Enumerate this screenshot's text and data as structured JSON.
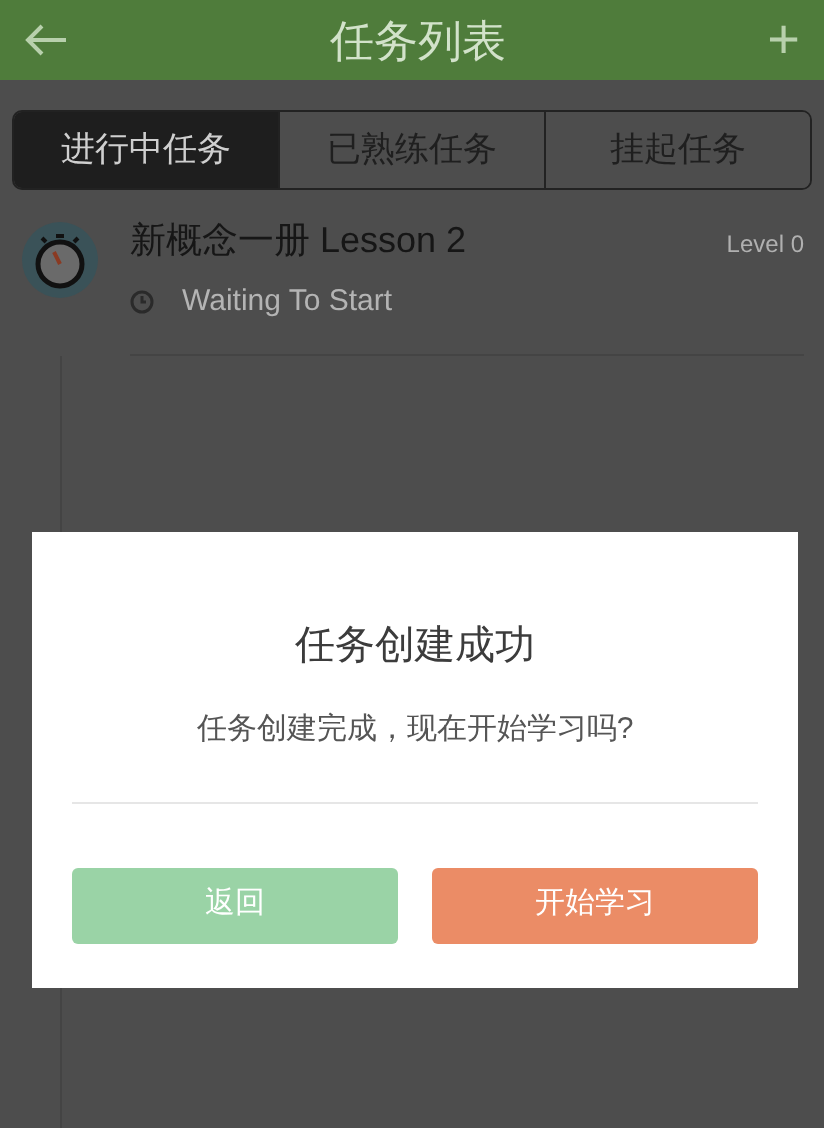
{
  "header": {
    "title": "任务列表",
    "add_label": "+"
  },
  "tabs": [
    {
      "label": "进行中任务",
      "selected": true
    },
    {
      "label": "已熟练任务",
      "selected": false
    },
    {
      "label": "挂起任务",
      "selected": false
    }
  ],
  "tasks": [
    {
      "title": "新概念一册 Lesson 2",
      "level": "Level 0",
      "status": "Waiting To Start"
    }
  ],
  "dialog": {
    "title": "任务创建成功",
    "message": "任务创建完成，现在开始学习吗?",
    "buttons": [
      {
        "label": "返回",
        "kind": "secondary"
      },
      {
        "label": "开始学习",
        "kind": "primary"
      }
    ]
  }
}
